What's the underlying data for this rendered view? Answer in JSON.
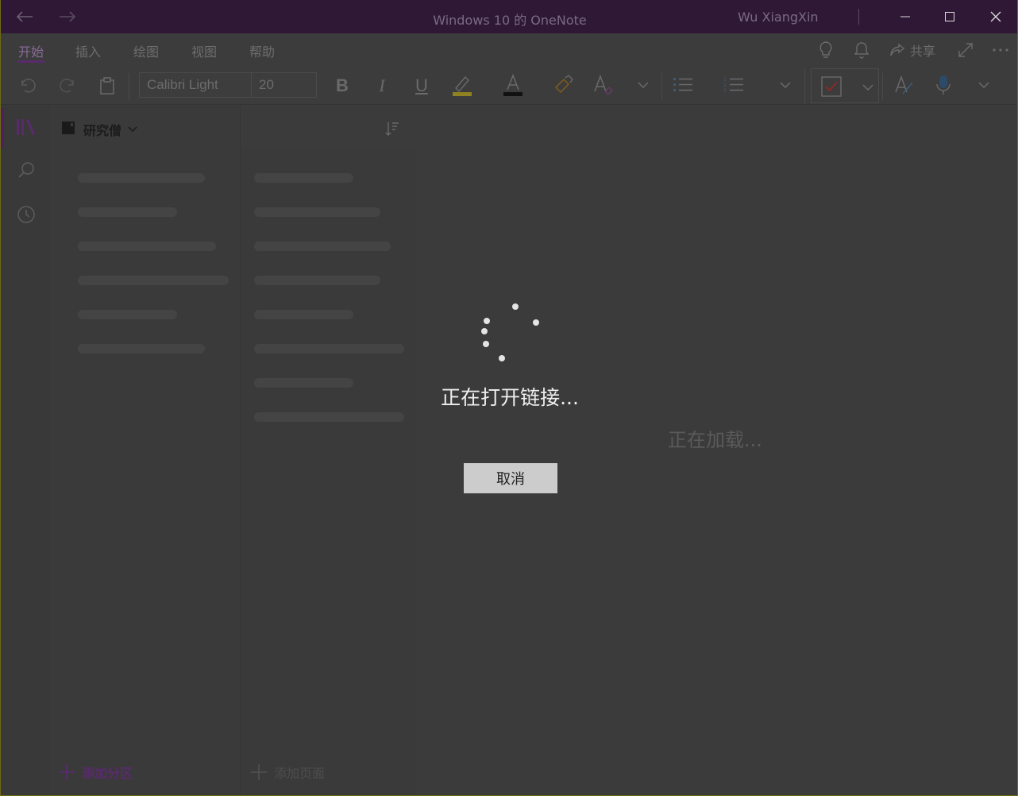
{
  "window": {
    "title": "Windows 10 的 OneNote",
    "user": "Wu XiangXin"
  },
  "ribbon": {
    "tabs": [
      "开始",
      "插入",
      "绘图",
      "视图",
      "帮助"
    ],
    "active_tab": "开始",
    "share_label": "共享",
    "font_name": "Calibri Light",
    "font_size": "20"
  },
  "notebook": {
    "name": "研究僧",
    "add_section_label": "添加分区",
    "add_page_label": "添加页面"
  },
  "canvas": {
    "loading_text": "正在加载..."
  },
  "dialog": {
    "message": "正在打开链接...",
    "cancel_label": "取消"
  },
  "colors": {
    "titlebar": "#2f1836",
    "accent": "#5a2a6d",
    "highlighter": "#b5a21e",
    "check_red": "#a33"
  }
}
